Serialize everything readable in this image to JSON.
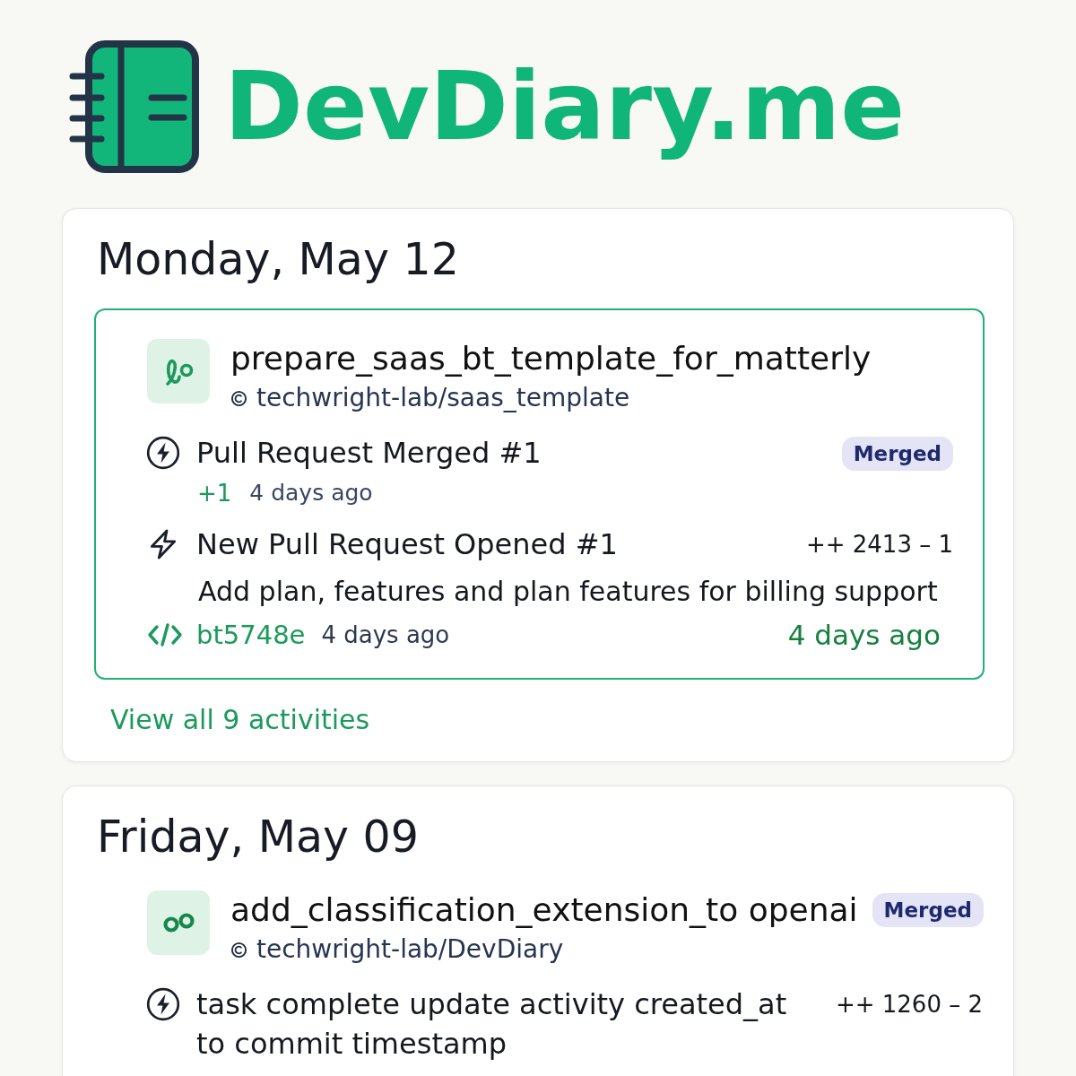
{
  "logo": {
    "text": "DevDiary.me"
  },
  "days": [
    {
      "date": "Monday, May 12",
      "groups": [
        {
          "kind": "branch",
          "highlighted": true,
          "title": "prepare_saas_bt_template_for_matterly",
          "repo": "techwright-lab/saas_template",
          "activities": [
            {
              "kind": "merged",
              "title": "Pull Request Merged #1",
              "badge": "Merged",
              "delta": "+1",
              "time": "4 days ago"
            },
            {
              "kind": "opened",
              "title": "New Pull Request Opened #1",
              "stats": "++ 2413 – 1",
              "message": "Add plan, features and plan features for billing support",
              "commit": "bt5748e",
              "commit_time": "4 days ago",
              "time": "4 days ago"
            }
          ]
        }
      ],
      "link": "View all 9 activities"
    },
    {
      "date": "Friday, May 09",
      "groups": [
        {
          "kind": "merge",
          "highlighted": false,
          "title": "add_classification_extension_to openai",
          "badge": "Merged",
          "repo": "techwright-lab/DevDiary",
          "activities": [
            {
              "kind": "task",
              "title": "task complete update activity created_at to commit timestamp",
              "stats": "++ 1260 – 2"
            }
          ]
        }
      ]
    }
  ]
}
